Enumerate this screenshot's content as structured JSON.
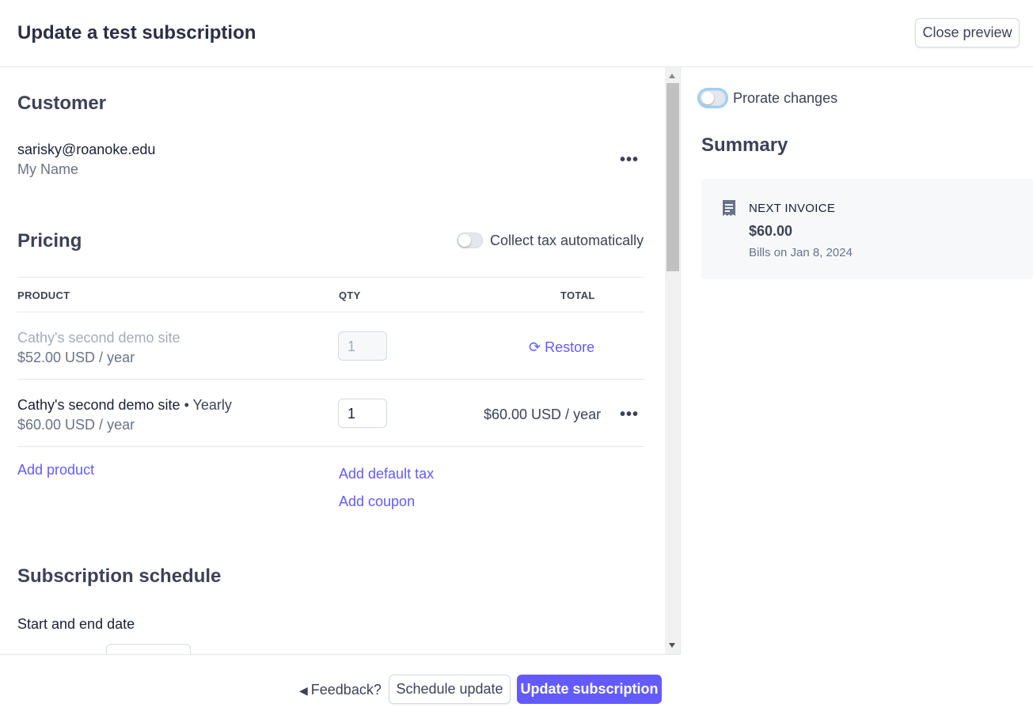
{
  "header": {
    "title": "Update a test subscription",
    "close_label": "Close preview"
  },
  "customer": {
    "heading": "Customer",
    "email": "sarisky@roanoke.edu",
    "name": "My Name",
    "more_label": "•••"
  },
  "pricing": {
    "heading": "Pricing",
    "collect_tax_label": "Collect tax automatically",
    "collect_tax_on": false,
    "columns": {
      "product": "PRODUCT",
      "qty": "QTY",
      "total": "TOTAL"
    },
    "rows": [
      {
        "product": "Cathy's second demo site",
        "price": "$52.00 USD / year",
        "qty": "1",
        "action": "Restore",
        "removed": true
      },
      {
        "product": "Cathy's second demo site",
        "interval": "• Yearly",
        "price": "$60.00 USD / year",
        "qty": "1",
        "total": "$60.00 USD / year",
        "more_label": "•••",
        "removed": false
      }
    ],
    "add_product": "Add product",
    "add_default_tax": "Add default tax",
    "add_coupon": "Add coupon"
  },
  "schedule": {
    "heading": "Subscription schedule",
    "start_end_label": "Start and end date"
  },
  "footer": {
    "feedback": "Feedback?",
    "schedule_update": "Schedule update",
    "update_subscription": "Update subscription"
  },
  "right": {
    "prorate_label": "Prorate changes",
    "prorate_on": false,
    "summary_heading": "Summary",
    "next_invoice_label": "NEXT INVOICE",
    "next_invoice_amount": "$60.00",
    "bills_on": "Bills on Jan 8, 2024"
  },
  "colors": {
    "accent": "#635bff",
    "text": "#1a1f36",
    "muted": "#697386",
    "border": "#e3e8ee"
  }
}
